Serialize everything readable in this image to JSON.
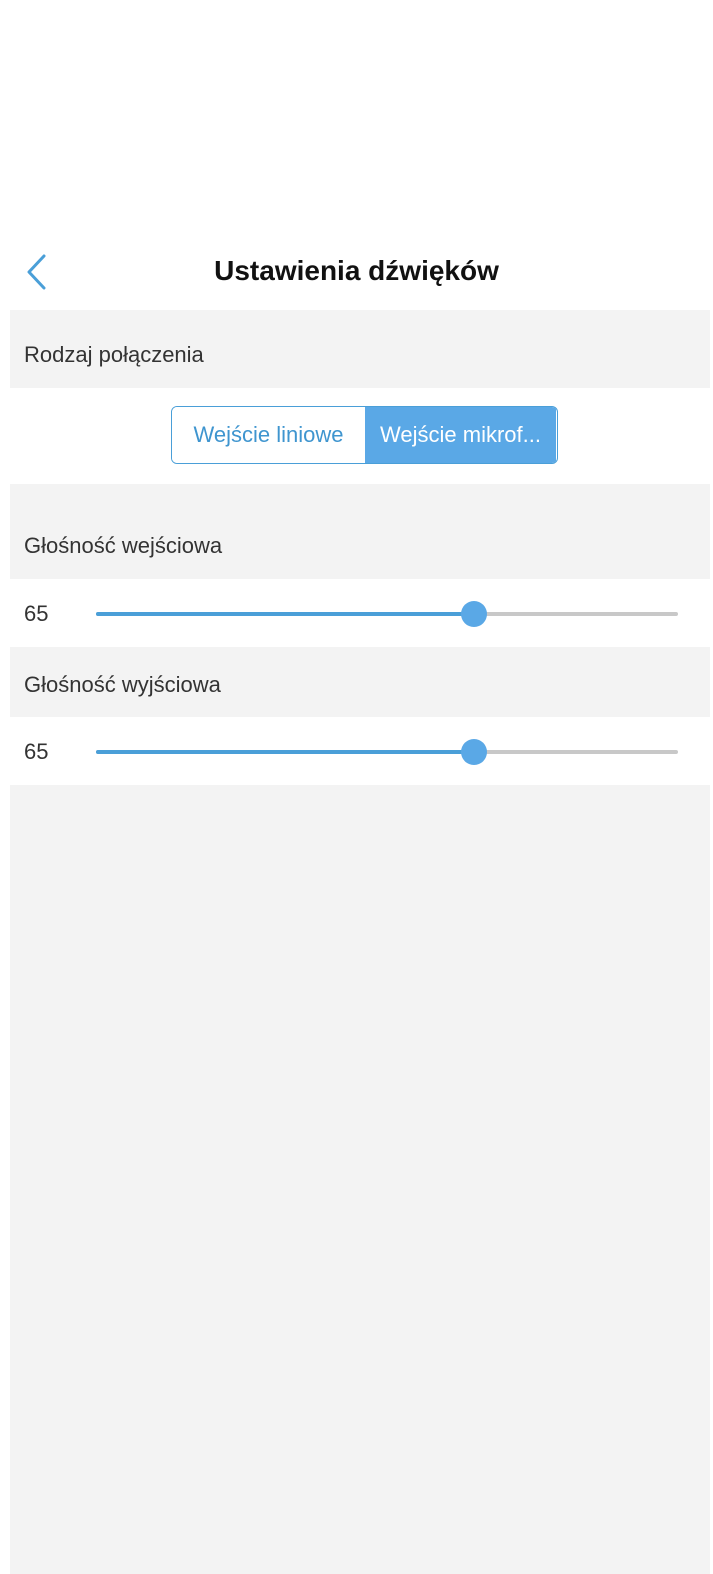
{
  "header": {
    "title": "Ustawienia dźwięków",
    "back_icon": "chevron-left-icon"
  },
  "connection": {
    "label": "Rodzaj połączenia",
    "options": [
      "Wejście liniowe",
      "Wejście mikrof..."
    ],
    "selected": "Wejście mikrof..."
  },
  "input_volume": {
    "label": "Głośność wejściowa",
    "value": "65",
    "fraction": 0.65
  },
  "output_volume": {
    "label": "Głośność wyjściowa",
    "value": "65",
    "fraction": 0.65
  },
  "colors": {
    "accent": "#5aa8e6",
    "accent_text": "#3f95cf",
    "background": "#f3f3f3",
    "track": "#c8c8c8"
  }
}
